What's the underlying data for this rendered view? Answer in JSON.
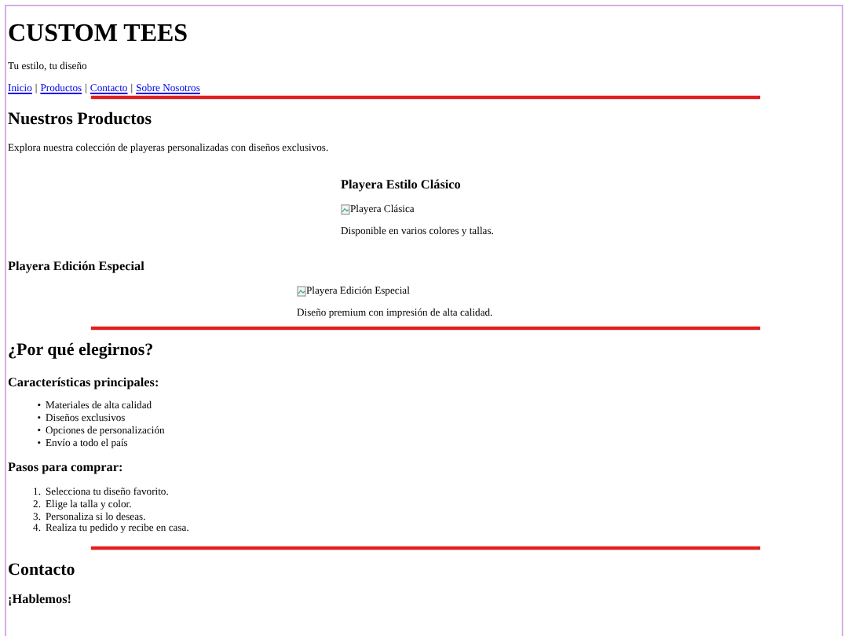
{
  "header": {
    "title": "CUSTOM TEES",
    "tagline": "Tu estilo, tu diseño",
    "nav": [
      "Inicio",
      "Productos",
      "Contacto",
      "Sobre Nosotros"
    ],
    "nav_separator": "|"
  },
  "products_section": {
    "heading": "Nuestros Productos",
    "intro": "Explora nuestra colección de playeras personalizadas con diseños exclusivos.",
    "products": [
      {
        "name": "Playera Estilo Clásico",
        "image_alt": "Playera Clásica",
        "description": "Disponible en varios colores y tallas."
      },
      {
        "name": "Playera Edición Especial",
        "image_alt": "Playera Edición Especial",
        "description": "Diseño premium con impresión de alta calidad."
      }
    ]
  },
  "why_section": {
    "heading": "¿Por qué elegirnos?",
    "features_heading": "Características principales:",
    "features": [
      {
        "marker": "•",
        "text": "Materiales de alta calidad"
      },
      {
        "marker": "•",
        "text": "Diseños exclusivos"
      },
      {
        "marker": "•",
        "text": "Opciones de personalización"
      },
      {
        "marker": "•",
        "text": "Envío a todo el país"
      }
    ],
    "steps_heading": "Pasos para comprar:",
    "steps": [
      {
        "marker": "1.",
        "text": "Selecciona tu diseño favorito."
      },
      {
        "marker": "2.",
        "text": "Elige la talla y color."
      },
      {
        "marker": "3.",
        "text": "Personaliza si lo deseas."
      },
      {
        "marker": "4.",
        "text": "Realiza tu pedido y recibe en casa."
      }
    ]
  },
  "contact_section": {
    "heading": "Contacto",
    "subheading": "¡Hablemos!"
  }
}
